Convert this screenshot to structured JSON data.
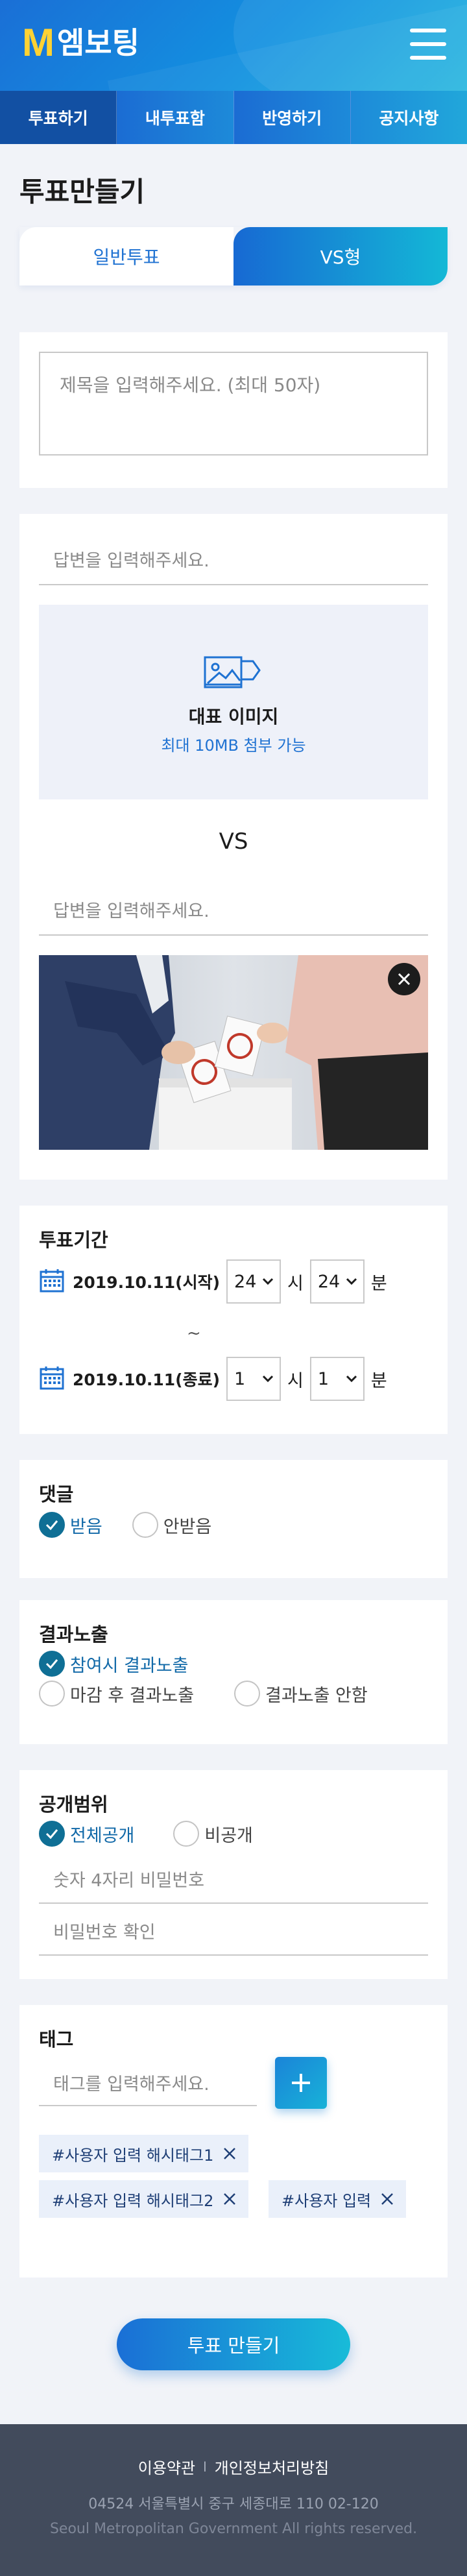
{
  "header": {
    "logo_mark": "M",
    "logo_text": "엠보팅",
    "menu_icon": "hamburger-menu-icon",
    "brand_gradient": [
      "#1a6fd6",
      "#20b4de"
    ],
    "logo_color": "#ffd233"
  },
  "nav": {
    "tabs": [
      {
        "label": "투표하기",
        "active": true
      },
      {
        "label": "내투표함",
        "active": false
      },
      {
        "label": "반영하기",
        "active": false
      },
      {
        "label": "공지사항",
        "active": false
      }
    ]
  },
  "page": {
    "title": "투표만들기",
    "vote_type": {
      "normal": "일반투표",
      "vs": "VS형",
      "selected": "VS형"
    }
  },
  "form": {
    "title_placeholder": "제목을 입력해주세요. (최대 50자)",
    "answer1_placeholder": "답변을 입력해주세요.",
    "upload": {
      "icon": "image-upload-icon",
      "title": "대표 이미지",
      "subtitle": "최대 10MB 첨부 가능"
    },
    "vs_label": "VS",
    "answer2_placeholder": "답변을 입력해주세요.",
    "photo_close_icon": "close-icon"
  },
  "period": {
    "title": "투표기간",
    "start": {
      "date": "2019.10.11(시작)",
      "hour": "24",
      "hour_unit": "시",
      "minute": "24",
      "minute_unit": "분"
    },
    "tilde": "~",
    "end": {
      "date": "2019.10.11(종료)",
      "hour": "1",
      "hour_unit": "시",
      "minute": "1",
      "minute_unit": "분"
    },
    "calendar_icon": "calendar-icon"
  },
  "comments": {
    "title": "댓글",
    "options": [
      {
        "label": "받음",
        "checked": true
      },
      {
        "label": "안받음",
        "checked": false
      }
    ]
  },
  "results": {
    "title": "결과노출",
    "options": [
      {
        "label": "참여시 결과노출",
        "checked": true
      },
      {
        "label": "마감 후 결과노출",
        "checked": false
      },
      {
        "label": "결과노출 안함",
        "checked": false
      }
    ]
  },
  "visibility": {
    "title": "공개범위",
    "options": [
      {
        "label": "전체공개",
        "checked": true
      },
      {
        "label": "비공개",
        "checked": false
      }
    ],
    "password_placeholder": "숫자 4자리 비밀번호",
    "password_confirm_placeholder": "비밀번호 확인"
  },
  "tags": {
    "title": "태그",
    "input_placeholder": "태그를 입력해주세요.",
    "add_icon": "plus-icon",
    "chips": [
      "#사용자 입력 해시태그1",
      "#사용자 입력 해시태그2",
      "#사용자 입력"
    ]
  },
  "submit_label": "투표 만들기",
  "footer": {
    "terms": "이용약관",
    "separator": "l",
    "privacy": "개인정보처리방침",
    "address": "04524 서울특별시 중구 세종대로 110    02-120",
    "copyright": "Seoul Metropolitan Government All rights reserved."
  }
}
